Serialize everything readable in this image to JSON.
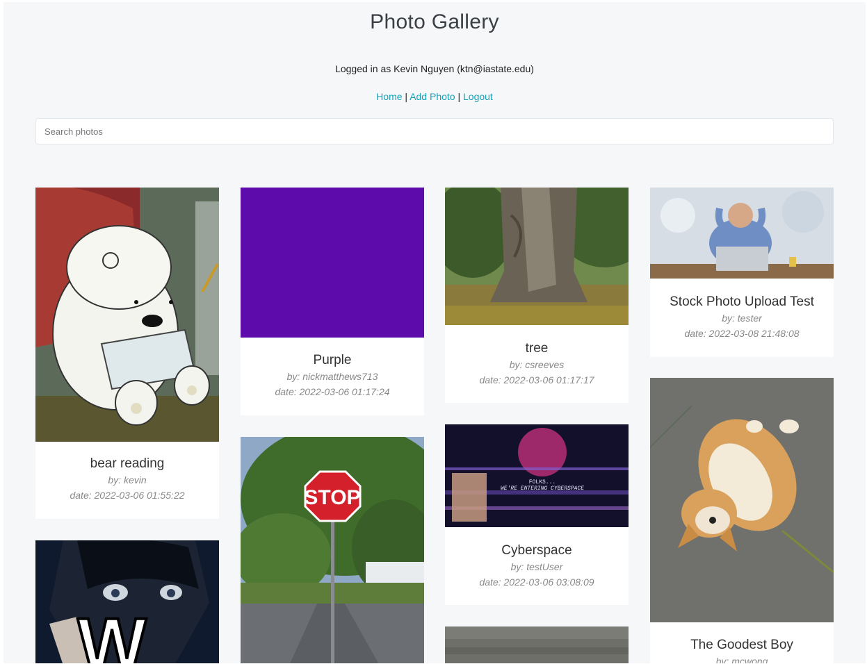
{
  "header": {
    "title": "Photo Gallery",
    "login_text": "Logged in as Kevin Nguyen (ktn@iastate.edu)",
    "nav": {
      "home": "Home",
      "add_photo": "Add Photo",
      "logout": "Logout",
      "separator": "|"
    }
  },
  "search": {
    "placeholder": "Search photos",
    "value": ""
  },
  "photos": [
    {
      "title": "bear reading",
      "by": "by: kevin",
      "date": "date: 2022-03-06 01:55:22"
    },
    {
      "title": "Purple",
      "by": "by: nickmatthews713",
      "date": "date: 2022-03-06 01:17:24"
    },
    {
      "title": "tree",
      "by": "by: csreeves",
      "date": "date: 2022-03-06 01:17:17"
    },
    {
      "title": "Stock Photo Upload Test",
      "by": "by: tester",
      "date": "date: 2022-03-08 21:48:08"
    },
    {
      "title": "Cyberspace",
      "by": "by: testUser",
      "date": "date: 2022-03-06 03:08:09"
    },
    {
      "title": "The Goodest Boy",
      "by": "by: mcwong",
      "date": ""
    }
  ],
  "image_text": {
    "stop_sign": "STOP",
    "w_letter": "W",
    "cyber_line1": "FOLKS...",
    "cyber_line2": "WE'RE ENTERING CYBERSPACE"
  },
  "colors": {
    "link": "#17a2b8",
    "purple_photo": "#5a0aa8",
    "background": "#f6f7f9"
  }
}
